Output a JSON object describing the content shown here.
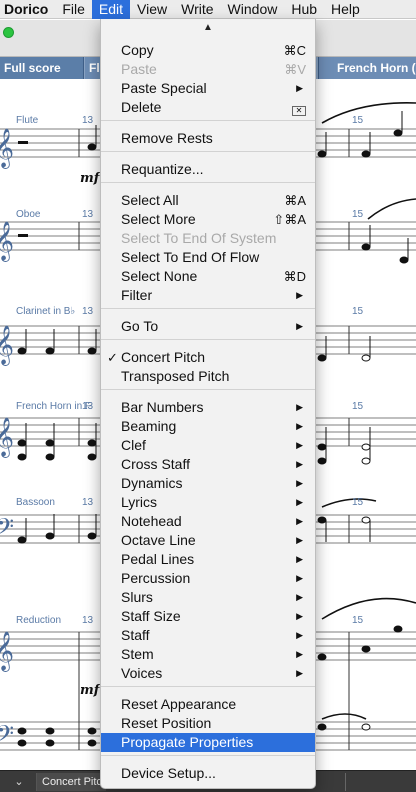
{
  "menubar": {
    "app_name": "Dorico",
    "items": [
      "File",
      "Edit",
      "View",
      "Write",
      "Window",
      "Hub",
      "Help"
    ]
  },
  "tabs": {
    "full_score": "Full score",
    "flute_partial": "Fl",
    "french_horn": "French Horn (F"
  },
  "score": {
    "instruments": [
      "Flute",
      "Oboe",
      "Clarinet in B♭",
      "French Horn in F",
      "Bassoon",
      "Reduction"
    ],
    "bar_numbers": {
      "left": "13",
      "right": "15"
    },
    "dynamic": "mf"
  },
  "edit_menu": {
    "items": [
      {
        "label": "Copy",
        "shortcut": "⌘C",
        "disabled": false
      },
      {
        "label": "Paste",
        "shortcut": "⌘V",
        "disabled": true
      },
      {
        "label": "Paste Special",
        "submenu": true
      },
      {
        "label": "Delete",
        "shortcut_icon": "delete-key-icon"
      },
      {
        "label": "Remove Rests"
      },
      {
        "label": "Requantize..."
      },
      {
        "label": "Select All",
        "shortcut": "⌘A"
      },
      {
        "label": "Select More",
        "shortcut": "⇧⌘A"
      },
      {
        "label": "Select To End Of System",
        "disabled": true
      },
      {
        "label": "Select To End Of Flow"
      },
      {
        "label": "Select None",
        "shortcut": "⌘D"
      },
      {
        "label": "Filter",
        "submenu": true
      },
      {
        "label": "Go To",
        "submenu": true
      },
      {
        "label": "Concert Pitch",
        "checked": true
      },
      {
        "label": "Transposed Pitch"
      },
      {
        "label": "Bar Numbers",
        "submenu": true
      },
      {
        "label": "Beaming",
        "submenu": true
      },
      {
        "label": "Clef",
        "submenu": true
      },
      {
        "label": "Cross Staff",
        "submenu": true
      },
      {
        "label": "Dynamics",
        "submenu": true
      },
      {
        "label": "Lyrics",
        "submenu": true
      },
      {
        "label": "Notehead",
        "submenu": true
      },
      {
        "label": "Octave Line",
        "submenu": true
      },
      {
        "label": "Pedal Lines",
        "submenu": true
      },
      {
        "label": "Percussion",
        "submenu": true
      },
      {
        "label": "Slurs",
        "submenu": true
      },
      {
        "label": "Staff Size",
        "submenu": true
      },
      {
        "label": "Staff",
        "submenu": true
      },
      {
        "label": "Stem",
        "submenu": true
      },
      {
        "label": "Voices",
        "submenu": true
      },
      {
        "label": "Reset Appearance"
      },
      {
        "label": "Reset Position"
      },
      {
        "label": "Propagate Properties",
        "highlighted": true
      },
      {
        "label": "Device Setup..."
      }
    ],
    "check_mark": "✓",
    "submenu_arrow": "▶",
    "scroll_up_arrow": "▲"
  },
  "statusbar": {
    "chevron": "⌄",
    "pitch_mode": "Concert Pitch"
  },
  "colors": {
    "menu_highlight": "#2c6fdc",
    "tab_active": "#5b7ea8",
    "staff_label": "#5a7aa6"
  }
}
